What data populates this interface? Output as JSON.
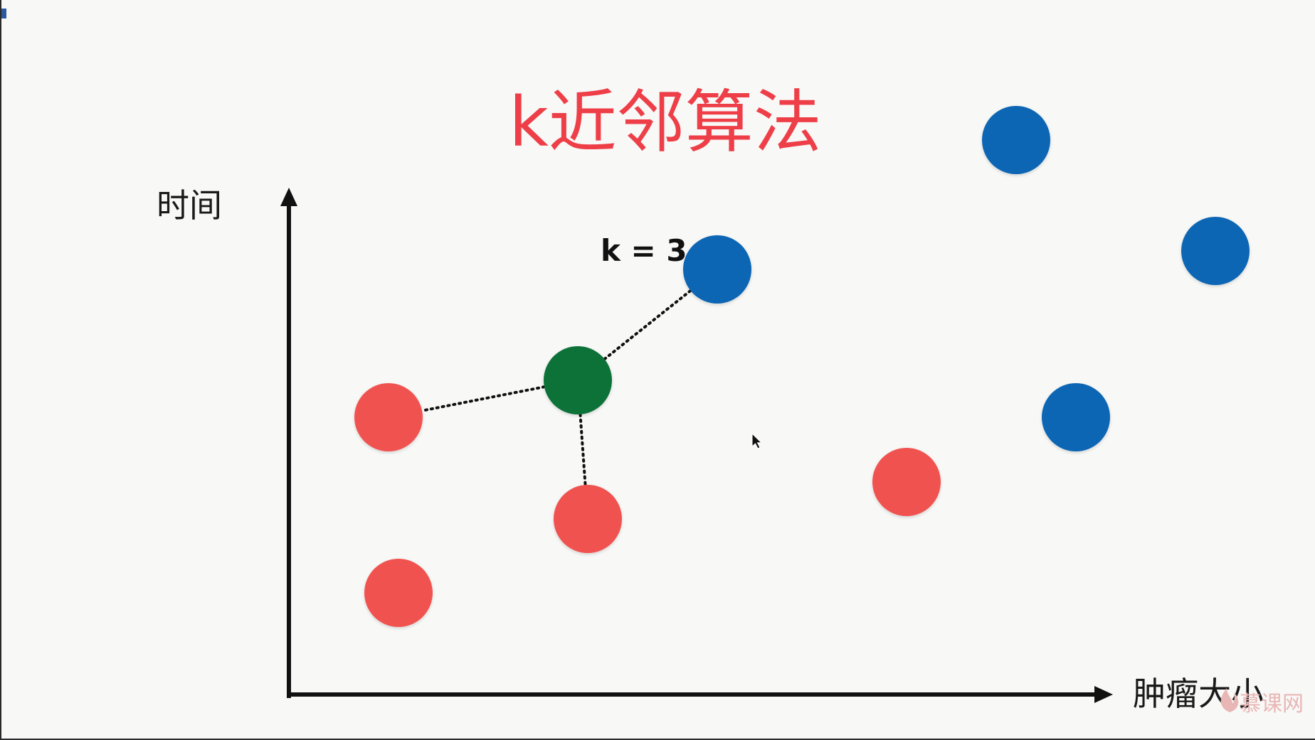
{
  "title": "k近邻算法",
  "y_axis_label": "时间",
  "x_axis_label": "肿瘤大小",
  "k_label": "k = 3",
  "watermark": "慕课网",
  "colors": {
    "title": "#ee3f48",
    "class_red": "#f0524f",
    "class_blue": "#0a66b4",
    "query_green": "#0b7239",
    "axis": "#111111"
  },
  "chart_data": {
    "type": "scatter",
    "k": 3,
    "series": [
      {
        "name": "",
        "class": "red",
        "points": [
          [
            1.0,
            3.0
          ],
          [
            3.0,
            1.9
          ],
          [
            1.1,
            1.1
          ],
          [
            6.2,
            2.3
          ]
        ]
      },
      {
        "name": "",
        "class": "blue",
        "points": [
          [
            4.3,
            4.6
          ],
          [
            7.3,
            6.0
          ],
          [
            9.3,
            4.8
          ],
          [
            7.9,
            3.0
          ]
        ]
      },
      {
        "name": "",
        "class": "green",
        "points": [
          [
            2.9,
            3.4
          ]
        ]
      }
    ],
    "neighbor_links": [
      {
        "from": [
          2.9,
          3.4
        ],
        "to": [
          1.0,
          3.0
        ]
      },
      {
        "from": [
          2.9,
          3.4
        ],
        "to": [
          3.0,
          1.9
        ]
      },
      {
        "from": [
          2.9,
          3.4
        ],
        "to": [
          4.3,
          4.6
        ]
      }
    ],
    "grid": false,
    "legend": "none"
  }
}
